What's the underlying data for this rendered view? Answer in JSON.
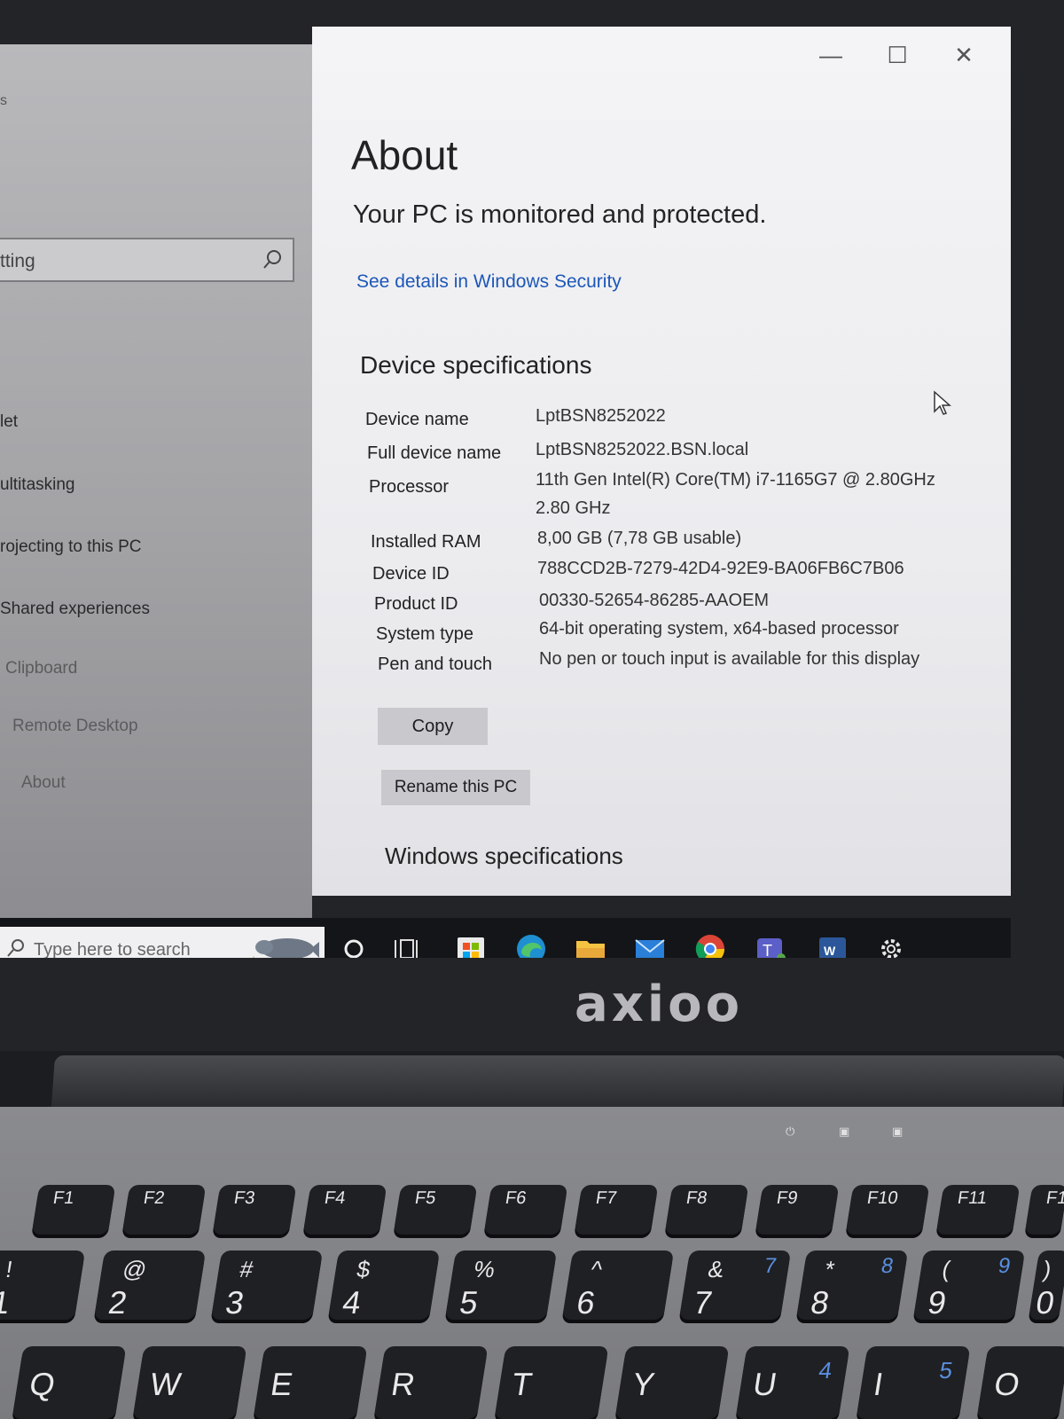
{
  "nav": {
    "top_text": "s",
    "search_placeholder": "tting",
    "items": [
      {
        "label": "let"
      },
      {
        "label": "ultitasking"
      },
      {
        "label": "rojecting to this PC"
      },
      {
        "label": "Shared experiences"
      },
      {
        "label": "Clipboard"
      },
      {
        "label": "Remote Desktop"
      },
      {
        "label": "About"
      }
    ]
  },
  "window_controls": {
    "minimize": "—",
    "maximize": "☐",
    "close": "✕"
  },
  "about": {
    "title": "About",
    "protection_status": "Your PC is monitored and protected.",
    "security_link": "See details in Windows Security",
    "device_specs_heading": "Device specifications",
    "specs": [
      {
        "label": "Device name",
        "value": "LptBSN8252022"
      },
      {
        "label": "Full device name",
        "value": "LptBSN8252022.BSN.local"
      },
      {
        "label": "Processor",
        "value": "11th Gen Intel(R) Core(TM) i7-1165G7 @ 2.80GHz",
        "value2": "2.80 GHz"
      },
      {
        "label": "Installed RAM",
        "value": "8,00 GB (7,78 GB usable)"
      },
      {
        "label": "Device ID",
        "value": "788CCD2B-7279-42D4-92E9-BA06FB6C7B06"
      },
      {
        "label": "Product ID",
        "value": "00330-52654-86285-AAOEM"
      },
      {
        "label": "System type",
        "value": "64-bit operating system, x64-based processor"
      },
      {
        "label": "Pen and touch",
        "value": "No pen or touch input is available for this display"
      }
    ],
    "copy_button": "Copy",
    "rename_button": "Rename this PC",
    "windows_specs_heading": "Windows specifications"
  },
  "taskbar": {
    "search_placeholder": "Type here to search",
    "icons": [
      "cortana-icon",
      "task-view-icon",
      "store-icon",
      "edge-icon",
      "file-explorer-icon",
      "mail-icon",
      "chrome-icon",
      "teams-icon",
      "word-icon",
      "settings-icon"
    ]
  },
  "laptop": {
    "brand": "axioo",
    "fn_keys": [
      "F1",
      "F2",
      "F3",
      "F4",
      "F5",
      "F6",
      "F7",
      "F8",
      "F9",
      "F10",
      "F11",
      "F1"
    ],
    "number_keys": [
      {
        "shift": "!",
        "main": "1"
      },
      {
        "shift": "@",
        "main": "2"
      },
      {
        "shift": "#",
        "main": "3"
      },
      {
        "shift": "$",
        "main": "4"
      },
      {
        "shift": "%",
        "main": "5"
      },
      {
        "shift": "^",
        "main": "6"
      },
      {
        "shift": "&",
        "main": "7",
        "num": "7"
      },
      {
        "shift": "*",
        "main": "8",
        "num": "8"
      },
      {
        "shift": "(",
        "main": "9",
        "num": "9"
      },
      {
        "shift": ")",
        "main": "0"
      }
    ],
    "letter_keys": [
      {
        "main": "Q"
      },
      {
        "main": "W"
      },
      {
        "main": "E"
      },
      {
        "main": "R"
      },
      {
        "main": "T"
      },
      {
        "main": "Y"
      },
      {
        "main": "U",
        "num": "4"
      },
      {
        "main": "I",
        "num": "5"
      },
      {
        "main": "O"
      }
    ]
  },
  "colors": {
    "link": "#1d57b8",
    "pane_bg": "#f0f0f2",
    "nav_bg": "#a8a8ab",
    "taskbar": "#141518",
    "key_num": "#5a8fe0"
  }
}
